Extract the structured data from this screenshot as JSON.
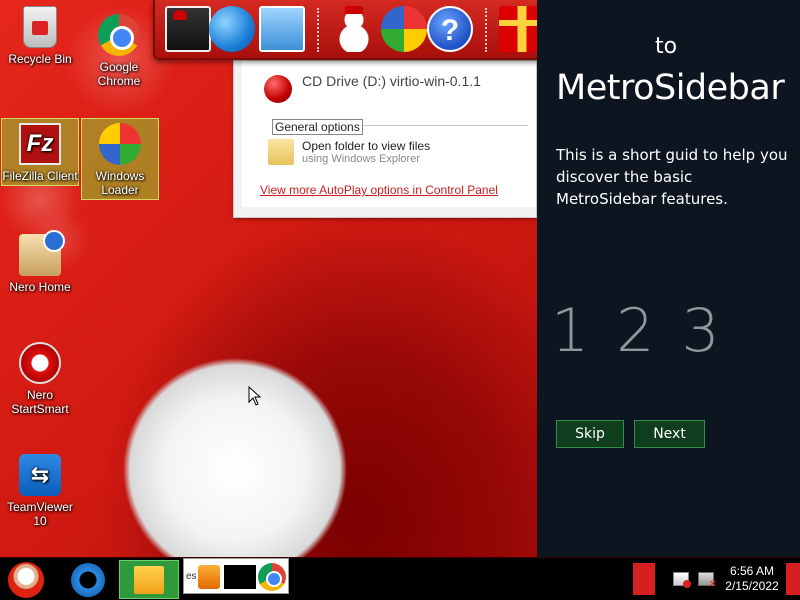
{
  "desktop": {
    "icons": [
      {
        "label": "Recycle Bin",
        "icon": "recycle-bin-icon"
      },
      {
        "label": "Google Chrome",
        "icon": "chrome-icon"
      },
      {
        "label": "FileZilla Client",
        "icon": "filezilla-icon",
        "glyph": "Fz"
      },
      {
        "label": "Windows Loader",
        "icon": "windows-loader-icon"
      },
      {
        "label": "Nero Home",
        "icon": "nero-home-icon"
      },
      {
        "label": "Nero StartSmart",
        "icon": "nero-startsmart-icon"
      },
      {
        "label": "TeamViewer 10",
        "icon": "teamviewer-icon",
        "glyph": "⇆"
      }
    ]
  },
  "top_dock": {
    "items": [
      "photo-icon",
      "globe-icon",
      "window-icon",
      "snowman-icon",
      "check-disk-icon",
      "help-icon",
      "gift-icon",
      "folder-icon",
      "recycle-bin-icon"
    ],
    "help_glyph": "?"
  },
  "autoplay": {
    "drive_title": "CD Drive (D:) virtio-win-0.1.1",
    "section_label": "General options",
    "option_main": "Open folder to view files",
    "option_sub": "using Windows Explorer",
    "more_link": "View more AutoPlay options in Control Panel"
  },
  "metro_sidebar": {
    "title_prefix": "to",
    "title": "MetroSidebar",
    "description": "This is a short guid to help you discover the basic MetroSidebar features.",
    "steps": "1 2 3",
    "skip_label": "Skip",
    "next_label": "Next",
    "button_color": "#0f3d1e"
  },
  "taskbar": {
    "preview_label": "es",
    "clock_time": "6:56 AM",
    "clock_date": "2/15/2022",
    "accent": "#d61f1f"
  }
}
